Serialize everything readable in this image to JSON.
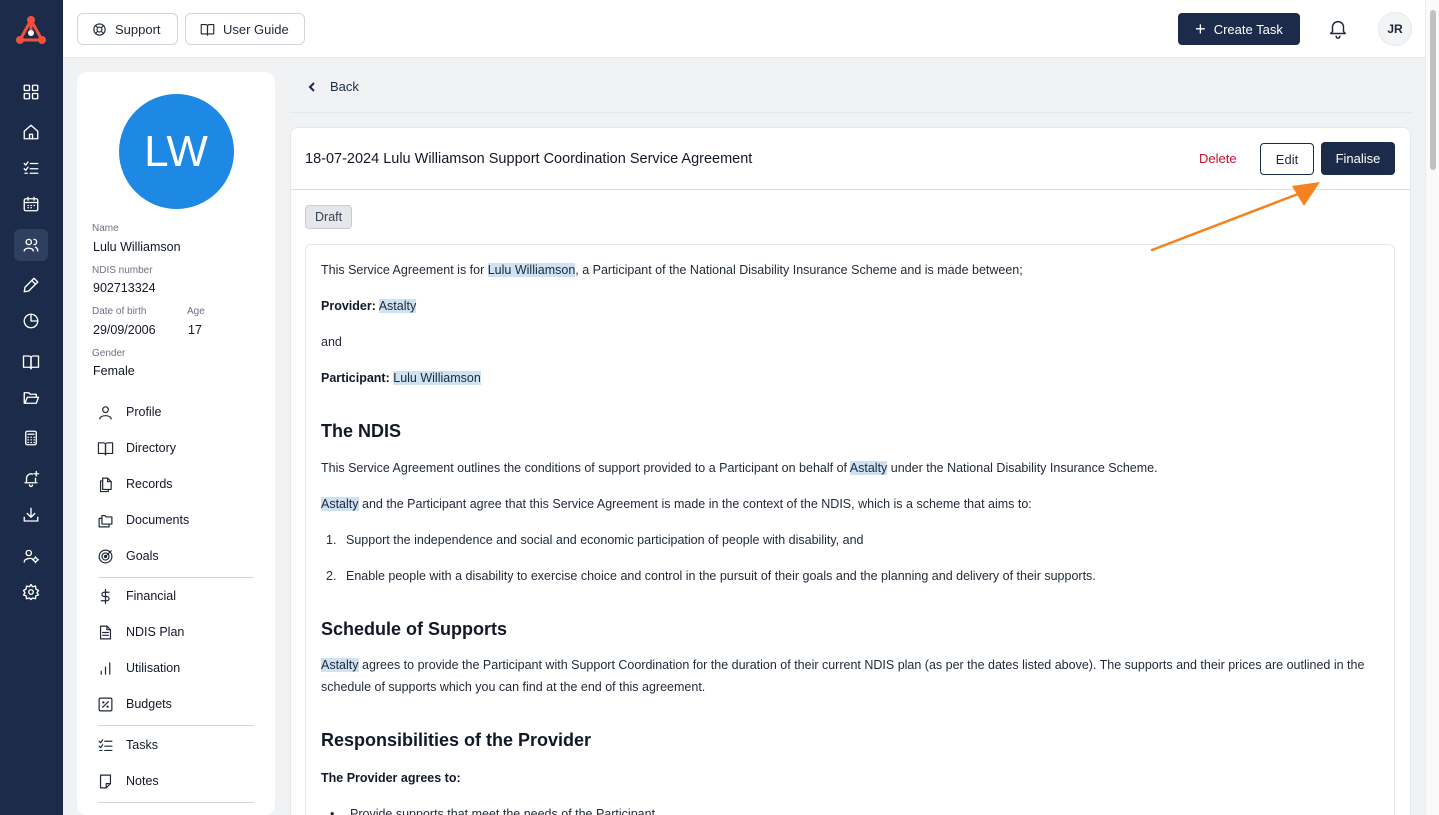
{
  "topbar": {
    "support_label": "Support",
    "user_guide_label": "User Guide",
    "create_task_label": "Create Task",
    "user_initials": "JR"
  },
  "rail": {
    "icons": [
      "dashboard-icon",
      "home-icon",
      "checklist-icon",
      "calendar-icon",
      "users-icon",
      "pen-icon",
      "pie-chart-icon",
      "book-icon",
      "folder-icon",
      "calculator-icon",
      "bell-plus-icon",
      "download-icon",
      "user-cog-icon",
      "settings-icon"
    ],
    "active": "users-icon"
  },
  "participant": {
    "initials": "LW",
    "avatar_color": "#1e88e5",
    "name_label": "Name",
    "name": "Lulu Williamson",
    "ndis_label": "NDIS number",
    "ndis_number": "902713324",
    "dob_label": "Date of birth",
    "dob": "29/09/2006",
    "age_label": "Age",
    "age": "17",
    "gender_label": "Gender",
    "gender": "Female"
  },
  "menu": {
    "group1": [
      "Profile",
      "Directory",
      "Records",
      "Documents",
      "Goals"
    ],
    "group2": [
      "Financial",
      "NDIS Plan",
      "Utilisation",
      "Budgets"
    ],
    "group3": [
      "Tasks",
      "Notes"
    ]
  },
  "back_label": "Back",
  "document": {
    "title": "18-07-2024 Lulu Williamson Support Coordination Service Agreement",
    "delete_label": "Delete",
    "edit_label": "Edit",
    "finalise_label": "Finalise",
    "status": "Draft",
    "intro_pre": "This Service Agreement is for ",
    "intro_name": "Lulu Williamson",
    "intro_post": ", a Participant of the National Disability Insurance Scheme and is made between;",
    "provider_label": "Provider:",
    "provider_name": "Astalty",
    "and_text": "and",
    "participant_label": "Participant:",
    "participant_name": "Lulu Williamson",
    "h_ndis": "The NDIS",
    "ndis_p1_pre": "This Service Agreement outlines the conditions of support provided to a Participant on behalf of ",
    "ndis_p1_org": "Astalty",
    "ndis_p1_post": " under the National Disability Insurance Scheme.",
    "ndis_p2_org": "Astalty",
    "ndis_p2_post": " and the Participant agree that this Service Agreement is made in the context of the NDIS, which is a scheme that aims to:",
    "ndis_list": [
      {
        "num": "1.",
        "text": "Support the independence and social and economic participation of people with disability, and"
      },
      {
        "num": "2.",
        "text": "Enable people with a disability to exercise choice and control in the pursuit of their goals and the planning and delivery of their supports."
      }
    ],
    "h_schedule": "Schedule of Supports",
    "schedule_org": "Astalty",
    "schedule_text": " agrees to provide the Participant with Support Coordination for the duration of their current NDIS plan (as per the dates listed above). The supports and their prices are outlined in the schedule of supports which you can find at the end of this agreement.",
    "h_resp": "Responsibilities of the Provider",
    "resp_intro": "The Provider agrees to:",
    "resp_first": "Provide supports that meet the needs of the Participant"
  },
  "colors": {
    "navy": "#1c2b4a",
    "delete_red": "#c8102e",
    "highlight": "#cfe2f3",
    "arrow": "#f58220"
  }
}
